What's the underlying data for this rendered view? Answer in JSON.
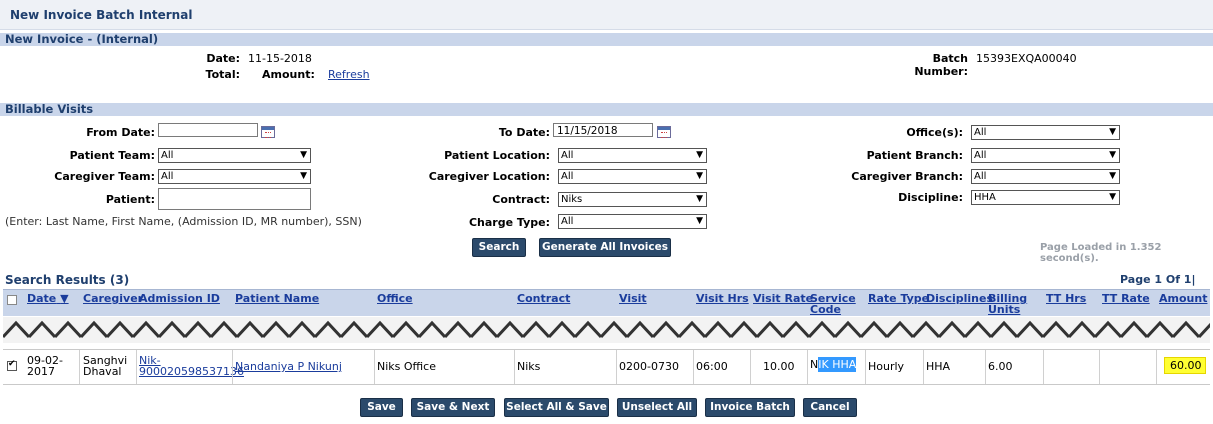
{
  "header": {
    "title": "New Invoice Batch Internal"
  },
  "invoice": {
    "section_title": "New Invoice - (Internal)",
    "date_label": "Date:",
    "date_value": "11-15-2018",
    "total_label": "Total:",
    "amount_label": "Amount:",
    "refresh_label": "Refresh",
    "batch_label": "Batch Number:",
    "batch_value": "15393EXQA00040"
  },
  "filters": {
    "section_title": "Billable Visits",
    "from_date_label": "From Date:",
    "from_date_value": "",
    "to_date_label": "To Date:",
    "to_date_value": "11/15/2018",
    "offices_label": "Office(s):",
    "offices_value": "All",
    "patient_team_label": "Patient Team:",
    "patient_team_value": "All",
    "patient_location_label": "Patient Location:",
    "patient_location_value": "All",
    "patient_branch_label": "Patient Branch:",
    "patient_branch_value": "All",
    "caregiver_team_label": "Caregiver Team:",
    "caregiver_team_value": "All",
    "caregiver_location_label": "Caregiver Location:",
    "caregiver_location_value": "All",
    "caregiver_branch_label": "Caregiver Branch:",
    "caregiver_branch_value": "All",
    "patient_label": "Patient:",
    "patient_value": "",
    "contract_label": "Contract:",
    "contract_value": "Niks",
    "discipline_label": "Discipline:",
    "discipline_value": "HHA",
    "charge_type_label": "Charge Type:",
    "charge_type_value": "All",
    "hint": "(Enter: Last Name, First Name, (Admission ID, MR number), SSN)",
    "search_button": "Search",
    "generate_button": "Generate All Invoices",
    "page_loaded": "Page Loaded in 1.352 second(s)."
  },
  "results": {
    "title": "Search Results",
    "count": "(3)",
    "page_info": "Page 1 Of 1|",
    "columns": {
      "date": "Date",
      "caregiver": "Caregiver",
      "admission_id": "Admission ID",
      "patient_name": "Patient Name",
      "office": "Office",
      "contract": "Contract",
      "visit": "Visit",
      "visit_hrs": "Visit Hrs",
      "visit_rate": "Visit Rate",
      "service_code_1": "Service",
      "service_code_2": "Code",
      "rate_type": "Rate Type",
      "disciplines": "Disciplines",
      "billing_units_1": "Billing",
      "billing_units_2": "Units",
      "tt_hrs": "TT Hrs",
      "tt_rate": "TT Rate",
      "amount": "Amount"
    },
    "row": {
      "date_1": "09-02-",
      "date_2": "2017",
      "caregiver_1": "Sanghvi",
      "caregiver_2": "Dhaval",
      "admission_1": "Nik-",
      "admission_2": "900020598537136",
      "patient_name": "Nandaniya P Nikunj",
      "office": "Niks Office",
      "contract": "Niks",
      "visit": "0200-0730",
      "visit_hrs": "06:00",
      "visit_rate": "10.00",
      "service_code_prefix": "N",
      "service_code_highlight": "IK HHA",
      "rate_type": "Hourly",
      "disciplines": "HHA",
      "billing_units": "6.00",
      "tt_hrs": "",
      "tt_rate": "",
      "amount": "60.00"
    }
  },
  "actions": {
    "save": "Save",
    "save_next": "Save & Next",
    "select_all_save": "Select All & Save",
    "unselect_all": "Unselect All",
    "invoice_batch": "Invoice Batch",
    "cancel": "Cancel"
  },
  "colors": {
    "accent": "#2b4a6b",
    "section": "#c9d5ea",
    "title_text": "#1f3f6e",
    "link": "#1a3c9c",
    "highlight_yellow": "#ffff33",
    "highlight_blue": "#3399ff"
  }
}
